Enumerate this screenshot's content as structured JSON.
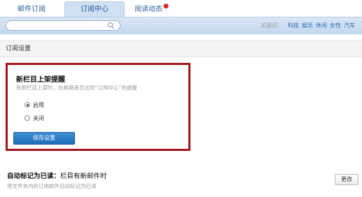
{
  "tabs": [
    {
      "label": "邮件订阅"
    },
    {
      "label": "订阅中心"
    },
    {
      "label": "阅读动态"
    }
  ],
  "search": {
    "placeholder": "",
    "value": ""
  },
  "keywords": {
    "label": "关键词：",
    "items": [
      "科技",
      "娱乐",
      "休闲",
      "女性",
      "汽车"
    ]
  },
  "section": {
    "title": "订阅设置"
  },
  "reminder": {
    "title": "新栏目上架提醒",
    "description": "有新栏目上架时，在邮箱首页出现“订阅中心”的提醒",
    "options": [
      {
        "label": "启用",
        "checked": true
      },
      {
        "label": "关闭",
        "checked": false
      }
    ],
    "save_label": "保存设置"
  },
  "automark": {
    "title_bold": "自动标记为已读：",
    "title_value": "栏目有新邮件时",
    "description": "将文件夹内的订阅邮件自动标记为已读",
    "change_label": "更改"
  }
}
